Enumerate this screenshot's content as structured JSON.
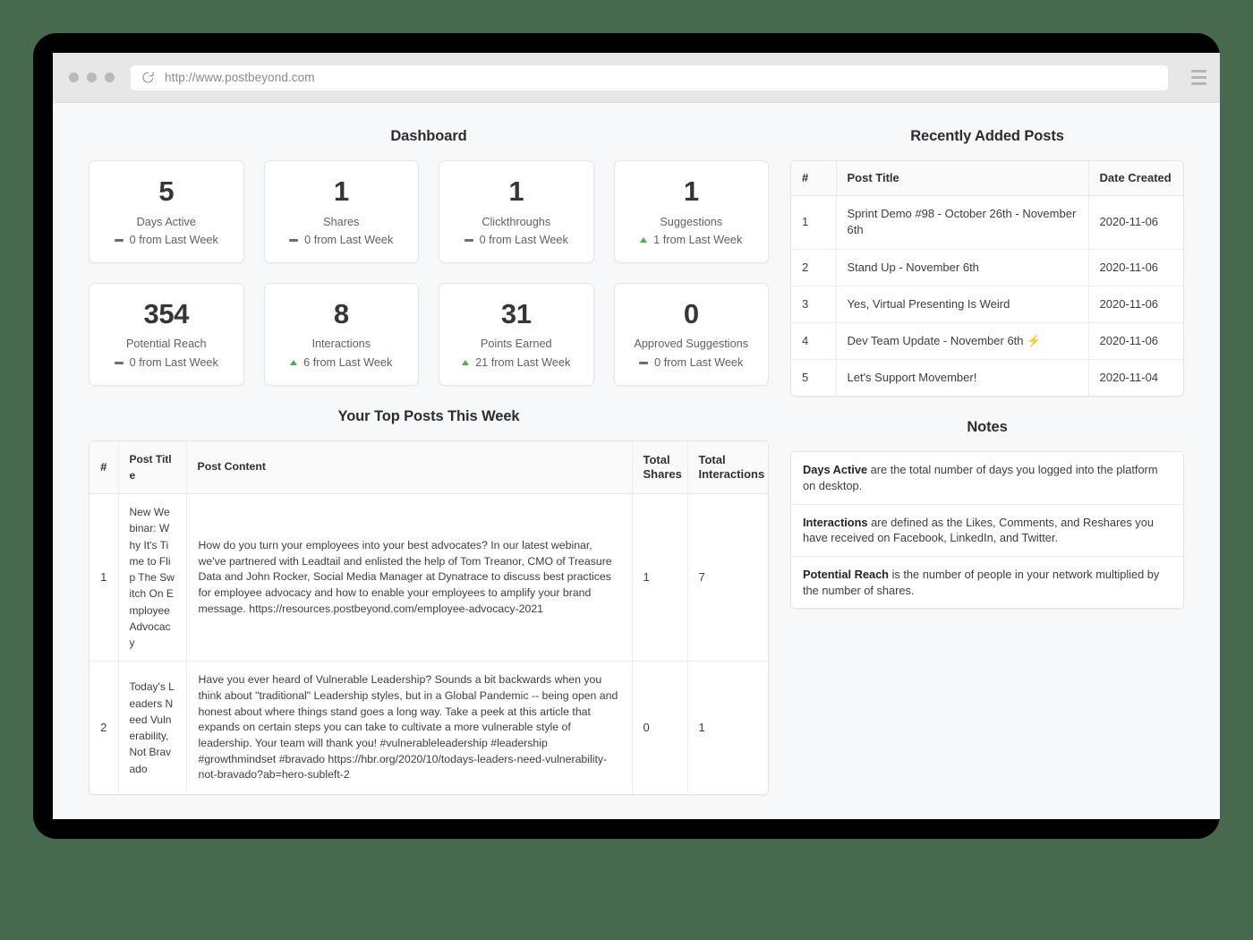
{
  "browser": {
    "url": "http://www.postbeyond.com",
    "reload_icon": "reload-icon",
    "menu_icon": "hamburger-menu-icon",
    "traffic_lights": [
      "close",
      "minimize",
      "maximize"
    ]
  },
  "colors": {
    "page_background": "#f6f8fa",
    "frame": "#000000",
    "desktop": "#47694d",
    "chrome": "#e7e7e7",
    "card_border": "#e4e6e8",
    "positive": "#4caf50",
    "flat": "#6a6e71",
    "text_primary": "#34373a",
    "text_secondary": "#5e6265"
  },
  "dashboard": {
    "title": "Dashboard",
    "stats": [
      {
        "value": "5",
        "label": "Days Active",
        "delta": "0 from Last Week",
        "trend": "flat"
      },
      {
        "value": "1",
        "label": "Shares",
        "delta": "0 from Last Week",
        "trend": "flat"
      },
      {
        "value": "1",
        "label": "Clickthroughs",
        "delta": "0 from Last Week",
        "trend": "flat"
      },
      {
        "value": "1",
        "label": "Suggestions",
        "delta": "1 from Last Week",
        "trend": "up"
      },
      {
        "value": "354",
        "label": "Potential Reach",
        "delta": "0 from Last Week",
        "trend": "flat"
      },
      {
        "value": "8",
        "label": "Interactions",
        "delta": "6 from Last Week",
        "trend": "up"
      },
      {
        "value": "31",
        "label": "Points Earned",
        "delta": "21 from Last Week",
        "trend": "up"
      },
      {
        "value": "0",
        "label": "Approved Suggestions",
        "delta": "0 from Last Week",
        "trend": "flat"
      }
    ]
  },
  "recently_added_posts": {
    "title": "Recently Added Posts",
    "columns": [
      "#",
      "Post Title",
      "Date Created"
    ],
    "rows": [
      {
        "num": "1",
        "title": "Sprint Demo #98 - October 26th - November 6th",
        "date": "2020-11-06",
        "bolt": ""
      },
      {
        "num": "2",
        "title": "Stand Up - November 6th",
        "date": "2020-11-06",
        "bolt": ""
      },
      {
        "num": "3",
        "title": "Yes, Virtual Presenting Is Weird",
        "date": "2020-11-06",
        "bolt": ""
      },
      {
        "num": "4",
        "title": "Dev Team Update - November 6th",
        "date": "2020-11-06",
        "bolt": "⚡"
      },
      {
        "num": "5",
        "title": "Let's Support Movember!",
        "date": "2020-11-04",
        "bolt": ""
      }
    ]
  },
  "top_posts": {
    "title": "Your Top Posts This Week",
    "columns": [
      "#",
      "Post Title",
      "Post Content",
      "Total Shares",
      "Total Interactions"
    ],
    "columns_multiline": {
      "shares_line1": "Total",
      "shares_line2": "Shares",
      "interactions_line1": "Total",
      "interactions_line2": "Interactions"
    },
    "rows": [
      {
        "num": "1",
        "title": "New Webinar: Why It's Time to Flip The Switch On Employee Advocacy",
        "content": "How do you turn your employees into your best advocates? In our latest webinar, we've partnered with Leadtail and enlisted the help of Tom Treanor, CMO of Treasure Data and John Rocker, Social Media Manager at Dynatrace to discuss best practices for employee advocacy and how to enable your employees to amplify your brand message. https://resources.postbeyond.com/employee-advocacy-2021",
        "shares": "1",
        "interactions": "7"
      },
      {
        "num": "2",
        "title": "Today's Leaders Need Vulnerability, Not Bravado",
        "content": "Have you ever heard of Vulnerable Leadership? Sounds a bit backwards when you think about \"traditional\" Leadership styles, but in a Global Pandemic -- being open and honest about where things stand goes a long way. Take a peek at this article that expands on certain steps you can take to cultivate a more vulnerable style of leadership. Your team will thank you! #vulnerableleadership #leadership #growthmindset #bravado https://hbr.org/2020/10/todays-leaders-need-vulnerability-not-bravado?ab=hero-subleft-2",
        "shares": "0",
        "interactions": "1"
      }
    ]
  },
  "notes": {
    "title": "Notes",
    "items": [
      {
        "term": "Days Active",
        "text": " are the total number of days you logged into the platform on desktop."
      },
      {
        "term": "Interactions",
        "text": " are defined as the Likes, Comments, and Reshares you have received on Facebook, LinkedIn, and Twitter."
      },
      {
        "term": "Potential Reach",
        "text": " is the number of people in your network multiplied by the number of shares."
      }
    ]
  }
}
